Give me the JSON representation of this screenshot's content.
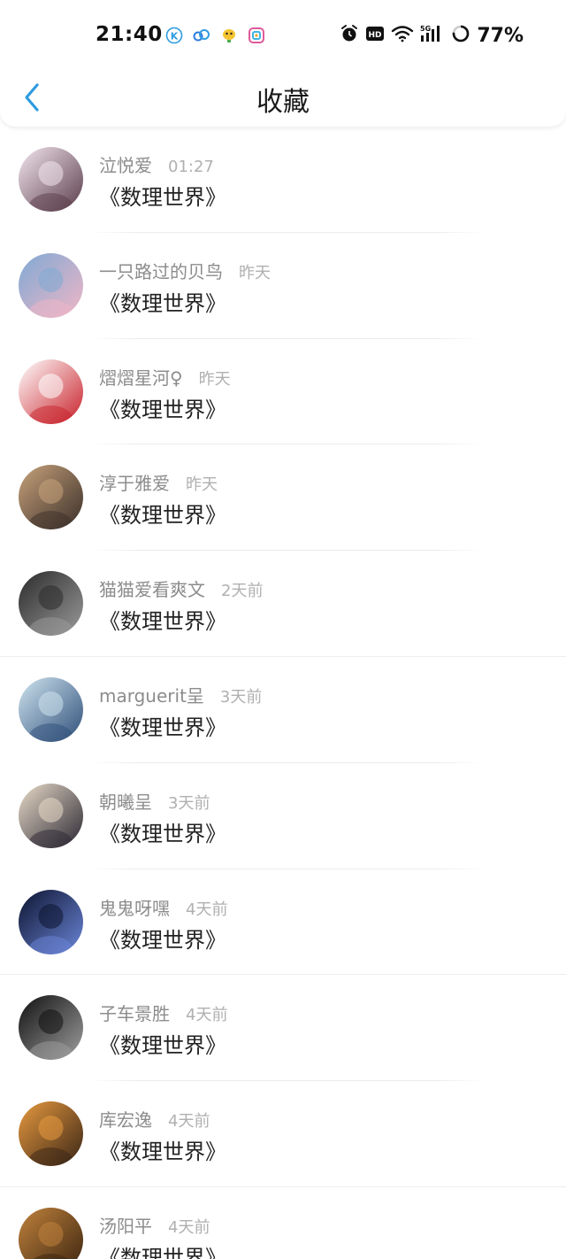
{
  "status_bar": {
    "time": "21:40",
    "network": "5G",
    "battery": "77%",
    "hd_label": "HD",
    "app_icons": [
      "k-app-icon",
      "cloud-app-icon",
      "duck-app-icon",
      "colorful-app-icon"
    ]
  },
  "nav": {
    "title": "收藏",
    "back_icon": "chevron-left-icon",
    "accent_color": "#2f9be0"
  },
  "items": [
    {
      "username": "泣悦爱",
      "time": "01:27",
      "title": "《数理世界》",
      "avatar_colors": [
        "#f3e6ef",
        "#5a3d4a"
      ]
    },
    {
      "username": "一只路过的贝鸟",
      "time": "昨天",
      "title": "《数理世界》",
      "avatar_colors": [
        "#7fa9d4",
        "#f0b6c6"
      ]
    },
    {
      "username": "熠熠星河♀",
      "time": "昨天",
      "title": "《数理世界》",
      "avatar_colors": [
        "#ffffff",
        "#c8212a"
      ]
    },
    {
      "username": "淳于雅爱",
      "time": "昨天",
      "title": "《数理世界》",
      "avatar_colors": [
        "#c7a27a",
        "#3b2f2a"
      ]
    },
    {
      "username": "猫猫爱看爽文",
      "time": "2天前",
      "title": "《数理世界》",
      "avatar_colors": [
        "#2b2b2b",
        "#9a9a9a"
      ]
    },
    {
      "username": "marguerit呈",
      "time": "3天前",
      "title": "《数理世界》",
      "avatar_colors": [
        "#cfe4ef",
        "#2f4f7a"
      ]
    },
    {
      "username": "朝曦呈",
      "time": "3天前",
      "title": "《数理世界》",
      "avatar_colors": [
        "#e9dbc9",
        "#2b2833"
      ]
    },
    {
      "username": "鬼鬼呀嘿",
      "time": "4天前",
      "title": "《数理世界》",
      "avatar_colors": [
        "#0d1430",
        "#6b86d8"
      ]
    },
    {
      "username": "子车景胜",
      "time": "4天前",
      "title": "《数理世界》",
      "avatar_colors": [
        "#111111",
        "#9e9e9e"
      ]
    },
    {
      "username": "库宏逸",
      "time": "4天前",
      "title": "《数理世界》",
      "avatar_colors": [
        "#e79a3f",
        "#3a2516"
      ]
    },
    {
      "username": "汤阳平",
      "time": "4天前",
      "title": "《数理世界》",
      "avatar_colors": [
        "#c0823c",
        "#3b2410"
      ]
    }
  ]
}
